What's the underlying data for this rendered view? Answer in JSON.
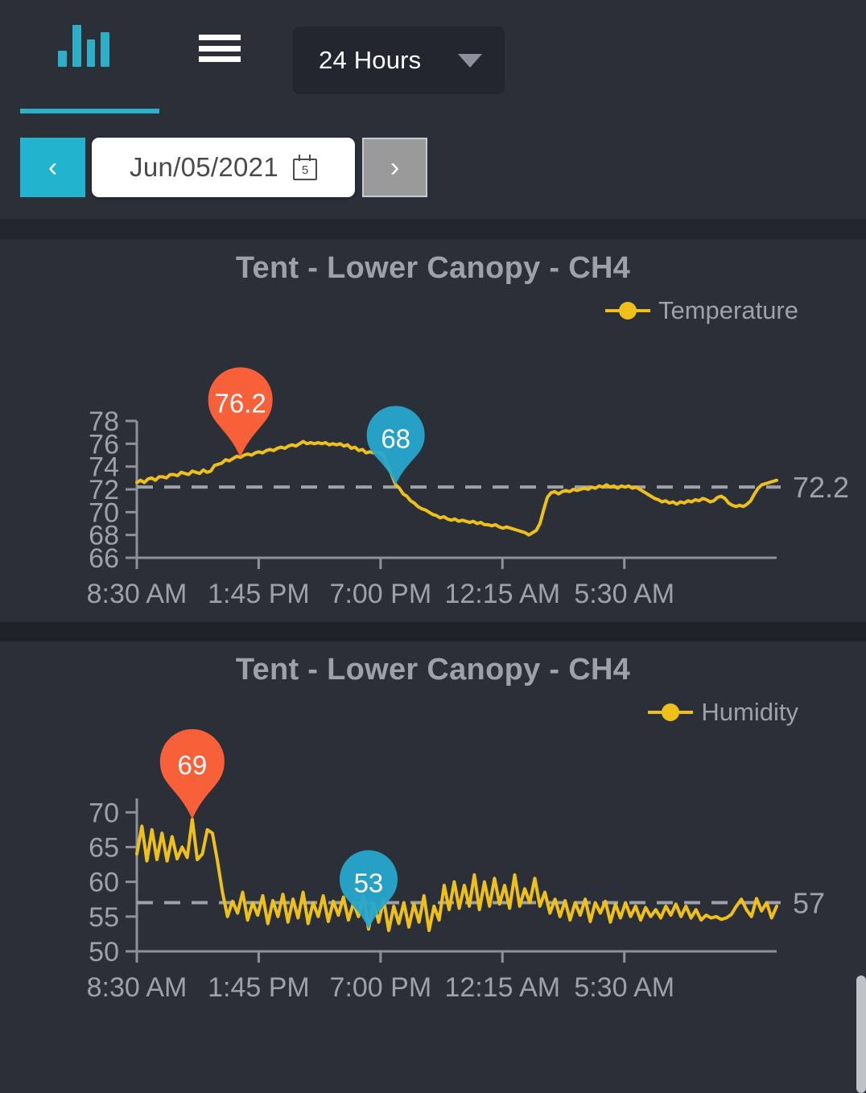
{
  "header": {
    "logo_name": "bar-chart-logo",
    "menu_name": "hamburger-menu",
    "range_label": "24 Hours",
    "caret_name": "chevron-down-icon",
    "prev_label": "‹",
    "next_label": "›",
    "date_value": "Jun/05/2021",
    "calendar_day": "5",
    "calendar_icon_name": "calendar-icon"
  },
  "charts": [
    {
      "title": "Tent - Lower Canopy - CH4",
      "legend_label": "Temperature",
      "high_marker": "76.2",
      "low_marker": "68",
      "avg_label": "72.2"
    },
    {
      "title": "Tent - Lower Canopy - CH4",
      "legend_label": "Humidity",
      "high_marker": "69",
      "low_marker": "53",
      "avg_label": "57"
    }
  ],
  "chart_data": [
    {
      "type": "line",
      "title": "Tent - Lower Canopy - CH4",
      "series_name": "Temperature",
      "xlabel": "",
      "ylabel": "",
      "ylim": [
        66,
        78
      ],
      "yticks": [
        66,
        68,
        70,
        72,
        74,
        76,
        78
      ],
      "xticks": [
        "8:30 AM",
        "1:45 PM",
        "7:00 PM",
        "12:15 AM",
        "5:30 AM"
      ],
      "grid": false,
      "legend_position": "top-right",
      "reference_line": {
        "value": 72.2,
        "label": "72.2",
        "style": "dashed"
      },
      "annotations": [
        {
          "label": "76.2",
          "kind": "max",
          "color": "#F8603A",
          "x_index": 28
        },
        {
          "label": "68",
          "kind": "min",
          "color": "#27A7CC",
          "x_index": 70
        }
      ],
      "values": [
        72.6,
        72.8,
        72.6,
        72.9,
        73.0,
        72.8,
        73.1,
        73.1,
        73.0,
        73.3,
        73.3,
        73.2,
        73.5,
        73.4,
        73.3,
        73.6,
        73.5,
        73.4,
        73.7,
        73.5,
        73.6,
        74.1,
        74.2,
        74.3,
        74.6,
        74.5,
        74.7,
        74.9,
        74.8,
        75.0,
        75.1,
        75.0,
        75.2,
        75.3,
        75.2,
        75.4,
        75.5,
        75.4,
        75.6,
        75.7,
        75.6,
        75.8,
        75.9,
        75.8,
        76.0,
        76.2,
        76.0,
        76.1,
        76.0,
        76.1,
        76.0,
        76.1,
        75.9,
        76.0,
        75.9,
        76.0,
        75.8,
        75.9,
        75.6,
        75.7,
        75.4,
        75.5,
        75.2,
        75.3,
        75.2,
        75.3,
        75.2,
        74.8,
        74.0,
        73.2,
        72.4,
        72.1,
        71.6,
        71.4,
        71.0,
        70.8,
        70.5,
        70.3,
        70.2,
        70.0,
        69.8,
        69.7,
        69.5,
        69.6,
        69.4,
        69.3,
        69.4,
        69.2,
        69.3,
        69.2,
        69.1,
        69.2,
        69.0,
        69.1,
        68.9,
        68.9,
        68.8,
        68.9,
        68.7,
        68.6,
        68.7,
        68.6,
        68.5,
        68.4,
        68.3,
        68.2,
        68.0,
        68.2,
        68.4,
        69.0,
        70.2,
        71.3,
        71.7,
        71.8,
        71.6,
        71.8,
        71.9,
        71.8,
        72.0,
        71.9,
        72.0,
        72.1,
        72.0,
        72.2,
        72.1,
        72.3,
        72.2,
        72.4,
        72.2,
        72.3,
        72.1,
        72.3,
        72.2,
        72.3,
        72.1,
        72.2,
        72.0,
        71.8,
        71.6,
        71.4,
        71.2,
        71.1,
        70.9,
        71.0,
        70.8,
        70.9,
        70.7,
        70.9,
        70.8,
        71.0,
        70.9,
        71.1,
        71.0,
        71.2,
        71.1,
        70.9,
        71.0,
        71.3,
        71.4,
        71.2,
        70.8,
        70.6,
        70.5,
        70.6,
        70.5,
        70.7,
        71.0,
        71.6,
        72.1,
        72.4,
        72.5,
        72.6,
        72.7,
        72.8
      ]
    },
    {
      "type": "line",
      "title": "Tent - Lower Canopy - CH4",
      "series_name": "Humidity",
      "xlabel": "",
      "ylabel": "",
      "ylim": [
        50,
        72
      ],
      "yticks": [
        50,
        55,
        60,
        65,
        70
      ],
      "xticks": [
        "8:30 AM",
        "1:45 PM",
        "7:00 PM",
        "12:15 AM",
        "5:30 AM"
      ],
      "grid": false,
      "legend_position": "top-right",
      "reference_line": {
        "value": 57,
        "label": "57",
        "style": "dashed"
      },
      "annotations": [
        {
          "label": "69",
          "kind": "max",
          "color": "#F8603A",
          "x_index": 11
        },
        {
          "label": "53",
          "kind": "min",
          "color": "#27A7CC",
          "x_index": 46
        }
      ],
      "values": [
        64.0,
        68.0,
        63.0,
        67.5,
        63.2,
        67.0,
        63.0,
        66.5,
        63.3,
        65.0,
        63.5,
        69.0,
        63.2,
        64.0,
        67.5,
        67.0,
        63.0,
        58.5,
        55.0,
        57.2,
        55.5,
        58.5,
        54.5,
        57.0,
        55.2,
        58.0,
        54.0,
        57.3,
        55.0,
        58.2,
        54.2,
        57.5,
        54.8,
        58.5,
        54.0,
        57.0,
        55.0,
        58.0,
        54.3,
        57.2,
        55.2,
        57.8,
        54.5,
        57.0,
        55.0,
        58.0,
        53.2,
        57.0,
        54.2,
        57.5,
        53.0,
        56.5,
        54.0,
        57.0,
        53.5,
        56.8,
        54.2,
        58.0,
        53.0,
        56.5,
        54.5,
        59.5,
        56.0,
        60.0,
        56.2,
        59.5,
        56.5,
        61.0,
        56.0,
        60.0,
        56.5,
        60.5,
        56.8,
        59.5,
        56.2,
        61.0,
        56.5,
        59.0,
        57.0,
        60.5,
        56.5,
        58.5,
        55.5,
        57.5,
        55.0,
        57.3,
        54.5,
        57.0,
        55.2,
        57.5,
        54.3,
        57.0,
        55.5,
        57.2,
        54.2,
        56.8,
        54.8,
        57.0,
        55.0,
        56.5,
        54.5,
        56.3,
        55.0,
        56.0,
        54.8,
        56.5,
        55.2,
        56.8,
        55.0,
        56.5,
        54.8,
        56.0,
        54.5,
        55.2,
        54.8,
        55.0,
        54.6,
        54.8,
        55.3,
        56.5,
        57.5,
        56.0,
        55.0,
        57.6,
        55.8,
        57.0,
        54.8,
        56.5
      ]
    }
  ]
}
